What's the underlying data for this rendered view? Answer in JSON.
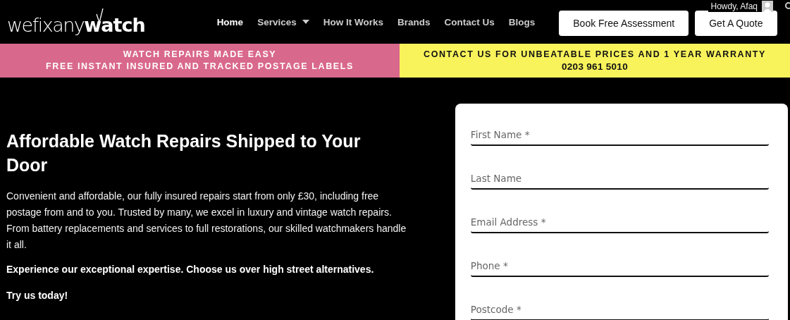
{
  "header": {
    "logo": {
      "light": "wefixany",
      "bold": "watch"
    },
    "nav": [
      {
        "label": "Home",
        "selected": true,
        "dropdown": false
      },
      {
        "label": "Services",
        "selected": false,
        "dropdown": true
      },
      {
        "label": "How It Works",
        "selected": false,
        "dropdown": false
      },
      {
        "label": "Brands",
        "selected": false,
        "dropdown": false
      },
      {
        "label": "Contact Us",
        "selected": false,
        "dropdown": false
      },
      {
        "label": "Blogs",
        "selected": false,
        "dropdown": false
      }
    ],
    "buttons": [
      "Book Free Assessment",
      "Get A Quote"
    ],
    "admin_bar": {
      "greeting": "Howdy, Afaq"
    }
  },
  "banners": [
    {
      "kind": "pink",
      "lines": [
        "WATCH REPAIRS MADE EASY",
        "FREE INSTANT INSURED AND TRACKED POSTAGE LABELS"
      ]
    },
    {
      "kind": "yellow",
      "lines": [
        "CONTACT US FOR UNBEATABLE PRICES AND 1 YEAR WARRANTY",
        "0203 961 5010"
      ]
    }
  ],
  "hero": {
    "heading": "Affordable Watch Repairs Shipped to Your Door",
    "paragraphs": [
      {
        "kind": "normal",
        "text": "Convenient and affordable, our fully insured repairs start from only £30, including free postage from and to you. Trusted by many, we excel in luxury and vintage watch repairs. From battery replacements and services to full restorations, our skilled watchmakers handle it all."
      },
      {
        "kind": "bold",
        "text": "Experience our exceptional expertise. Choose us over high street alternatives."
      },
      {
        "kind": "bold",
        "text": "Try us today!"
      }
    ]
  },
  "form": {
    "fields": [
      {
        "placeholder": "First Name *"
      },
      {
        "placeholder": "Last Name"
      },
      {
        "placeholder": "Email Address *"
      },
      {
        "placeholder": "Phone *"
      },
      {
        "placeholder": "Postcode *"
      }
    ]
  }
}
